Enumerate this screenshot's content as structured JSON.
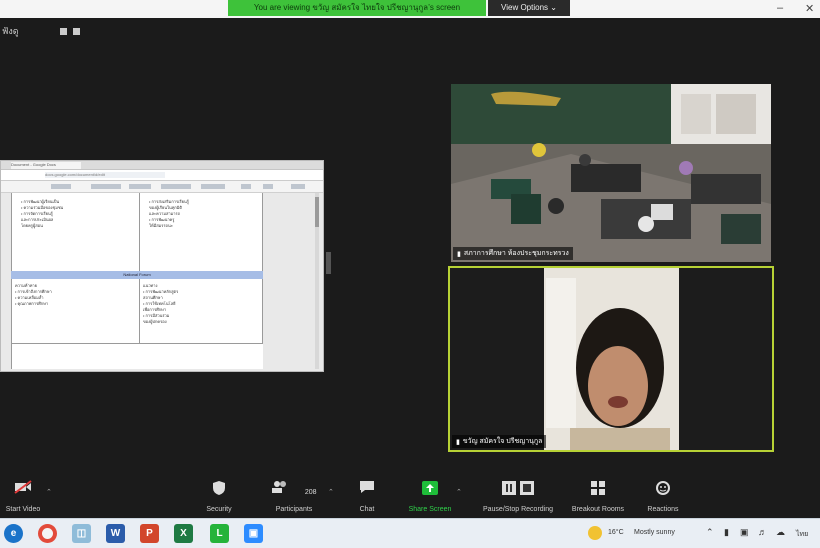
{
  "window": {
    "share_banner": "You are viewing ขวัญ สมัครใจ ไทยใจ ปรีชญานุกูล’s screen",
    "view_options": "View Options ⌄",
    "winctrl_min": "–",
    "winctrl_close": "✕",
    "top_left_text": "ฟังดู"
  },
  "shared_doc": {
    "tab_title": "Document - Google Docs",
    "url": "docs.google.com/document/d/edit",
    "table_heading": "National Forum",
    "col1_lines_top": [
      "• การพัฒนาผู้เรียนเป็น",
      "• ความร่วมมือของชุมชน",
      "• การจัดการเรียนรู้",
      "  และการประเมินผล",
      "  โดยครูผู้สอน"
    ],
    "col2_lines_top": [
      "• การส่งเสริมการเรียนรู้",
      "  ของผู้เรียนในทุกมิติ",
      "  และความสามารถ",
      "• การพัฒนาครู",
      "  ให้มีสมรรถนะ"
    ],
    "col1_lines_bottom": [
      "ความท้าทาย",
      "• การเข้าถึงการศึกษา",
      "• ความเหลื่อมล้ำ",
      "• คุณภาพการศึกษา"
    ],
    "col2_lines_bottom": [
      "แนวทาง",
      "• การพัฒนาหลักสูตร",
      "  สถานศึกษา",
      "• การใช้เทคโนโลยี",
      "  เพื่อการศึกษา",
      "• การมีส่วนร่วม",
      "  ของผู้ปกครอง"
    ]
  },
  "tiles": {
    "room_name": "สภาการศึกษา ห้องประชุมกระทรวง",
    "speaker_name": "ขวัญ สมัครใจ ปรีชญานุกูล",
    "accent_color": "#b7d235"
  },
  "toolbar": {
    "items": [
      {
        "label": "Start Video",
        "icon": "video-off-icon"
      },
      {
        "label": "Security",
        "icon": "shield-icon"
      },
      {
        "label": "Participants",
        "icon": "participants-icon",
        "count": "208"
      },
      {
        "label": "Chat",
        "icon": "chat-icon"
      },
      {
        "label": "Share Screen",
        "icon": "share-screen-icon"
      },
      {
        "label": "Pause/Stop Recording",
        "icon": "recording-icon"
      },
      {
        "label": "Breakout Rooms",
        "icon": "breakout-icon"
      },
      {
        "label": "Reactions",
        "icon": "reactions-icon"
      }
    ],
    "share_color": "#1fbd3a"
  },
  "taskbar": {
    "weather": "16°C",
    "weather_desc": "Mostly sunny",
    "lang": "ไทย",
    "apps": [
      "edge-icon",
      "chrome-icon",
      "files-icon",
      "word-icon",
      "powerpoint-icon",
      "excel-icon",
      "line-icon",
      "zoom-icon"
    ]
  }
}
